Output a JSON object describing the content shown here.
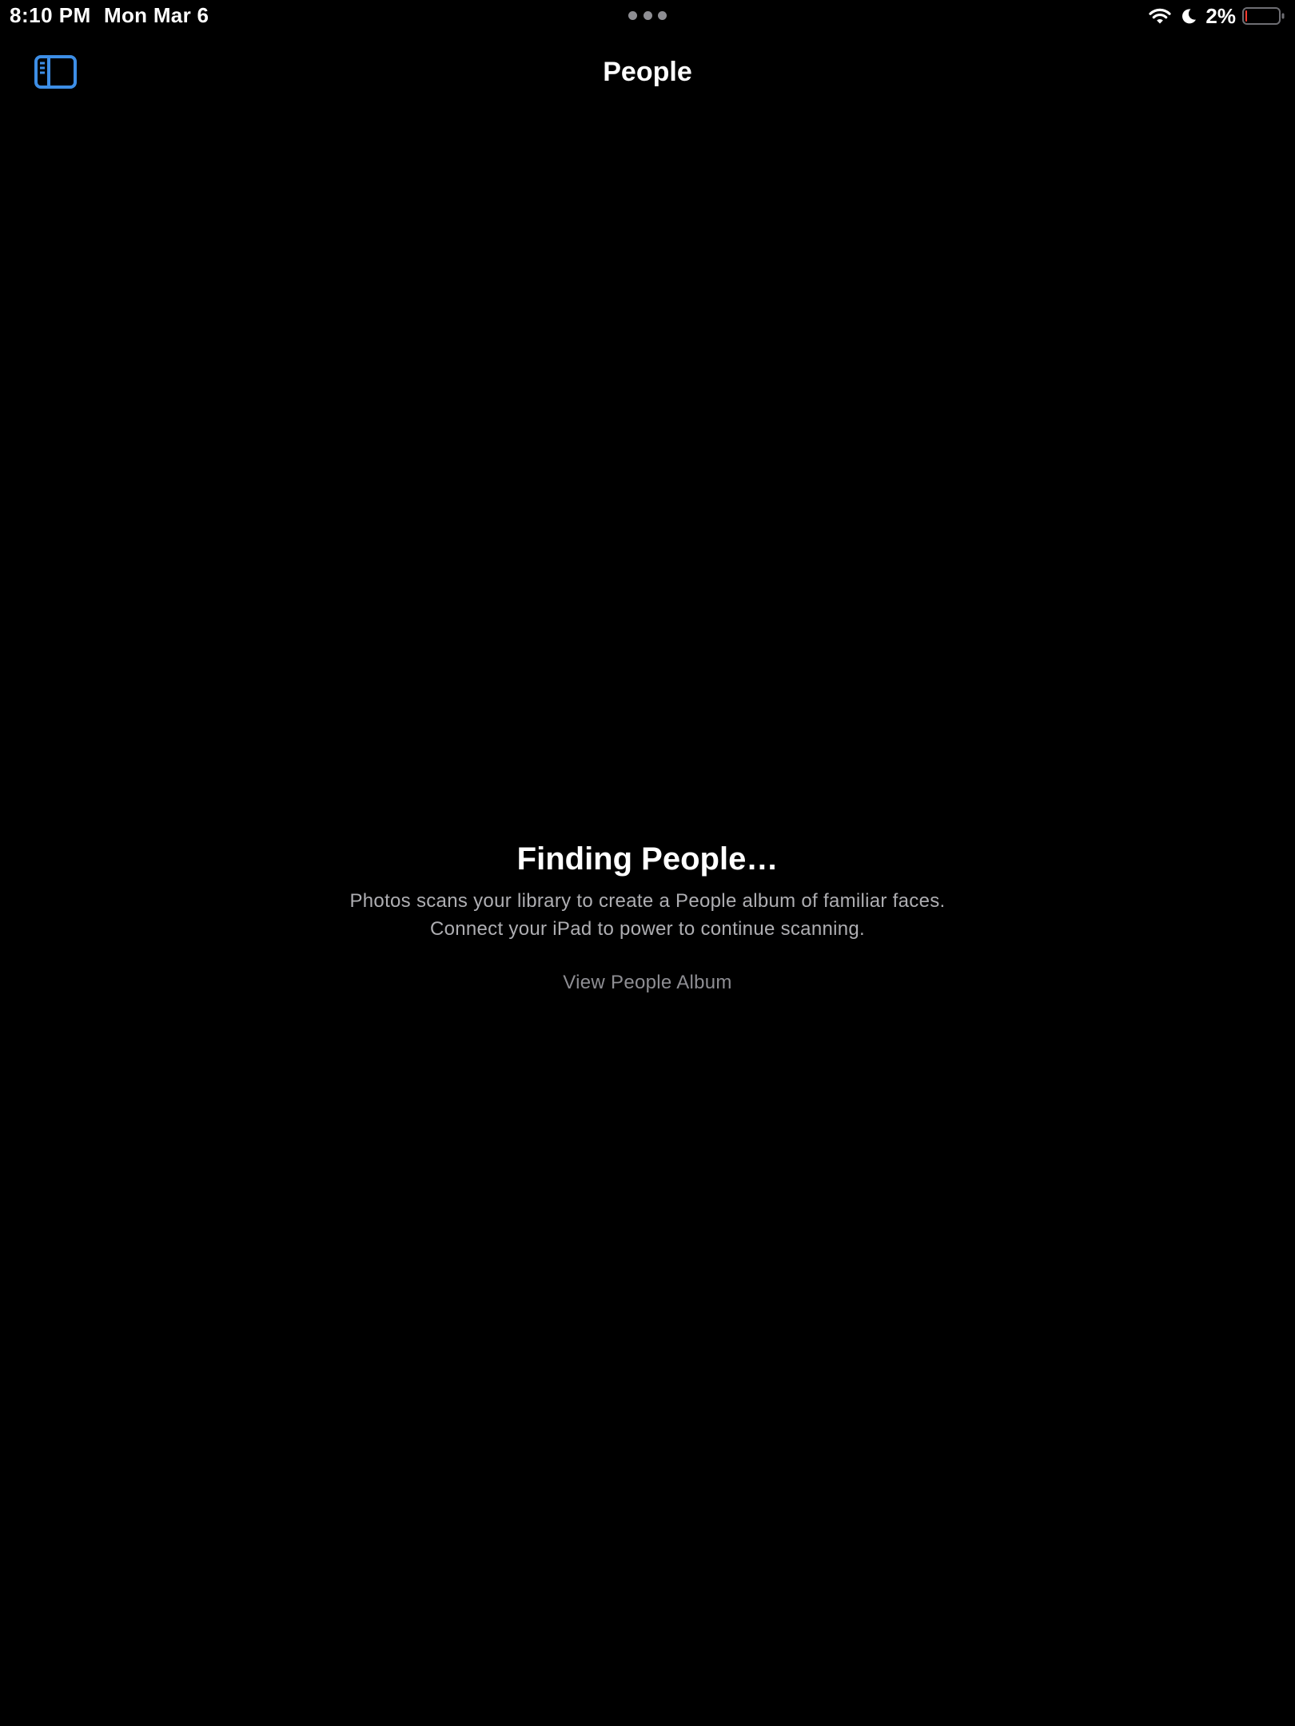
{
  "status_bar": {
    "time": "8:10 PM",
    "date": "Mon Mar 6",
    "battery_percent": "2%",
    "battery_level": 0.02,
    "icons": [
      "wifi-icon",
      "moon-icon",
      "battery-icon"
    ]
  },
  "nav": {
    "title": "People",
    "sidebar_toggle_icon": "sidebar-toggle-icon"
  },
  "empty_state": {
    "title": "Finding People…",
    "description_line1": "Photos scans your library to create a People album of familiar faces.",
    "description_line2": "Connect your iPad to power to continue scanning.",
    "link": "View People Album"
  },
  "colors": {
    "background": "#000000",
    "accent": "#3d8ee6",
    "secondary_text": "#aeaeb2",
    "battery_low": "#ff3b30"
  }
}
